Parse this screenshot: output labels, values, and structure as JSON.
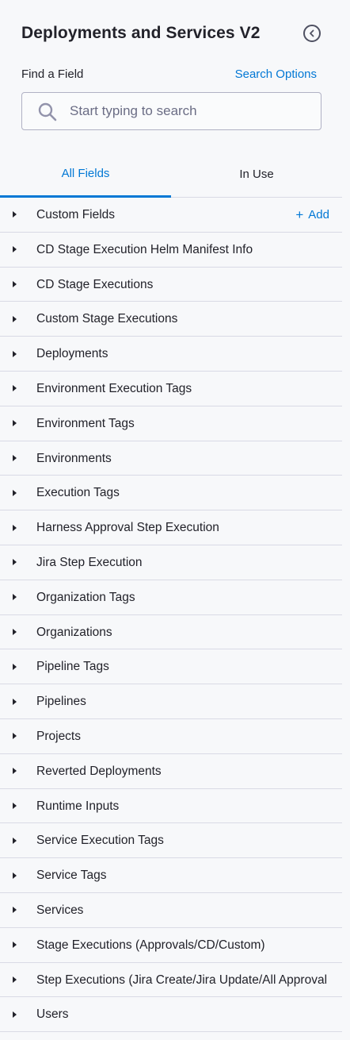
{
  "panel": {
    "title": "Deployments and Services V2",
    "collapse_icon": "chevron-left-circle-icon"
  },
  "find": {
    "label": "Find a Field",
    "search_options": "Search Options",
    "placeholder": "Start typing to search",
    "value": ""
  },
  "tabs": {
    "all_fields": "All Fields",
    "in_use": "In Use",
    "active": "All Fields"
  },
  "add_label": "Add",
  "rows": [
    "Custom Fields",
    "CD Stage Execution Helm Manifest Info",
    "CD Stage Executions",
    "Custom Stage Executions",
    "Deployments",
    "Environment Execution Tags",
    "Environment Tags",
    "Environments",
    "Execution Tags",
    "Harness Approval Step Execution",
    "Jira Step Execution",
    "Organization Tags",
    "Organizations",
    "Pipeline Tags",
    "Pipelines",
    "Projects",
    "Reverted Deployments",
    "Runtime Inputs",
    "Service Execution Tags",
    "Service Tags",
    "Services",
    "Stage Executions (Approvals/CD/Custom)",
    "Step Executions (Jira Create/Jira Update/All Approval",
    "Users"
  ],
  "colors": {
    "accent": "#0278d5",
    "text": "#22222a",
    "background": "#f7f8fa",
    "divider": "#d9dae5"
  }
}
